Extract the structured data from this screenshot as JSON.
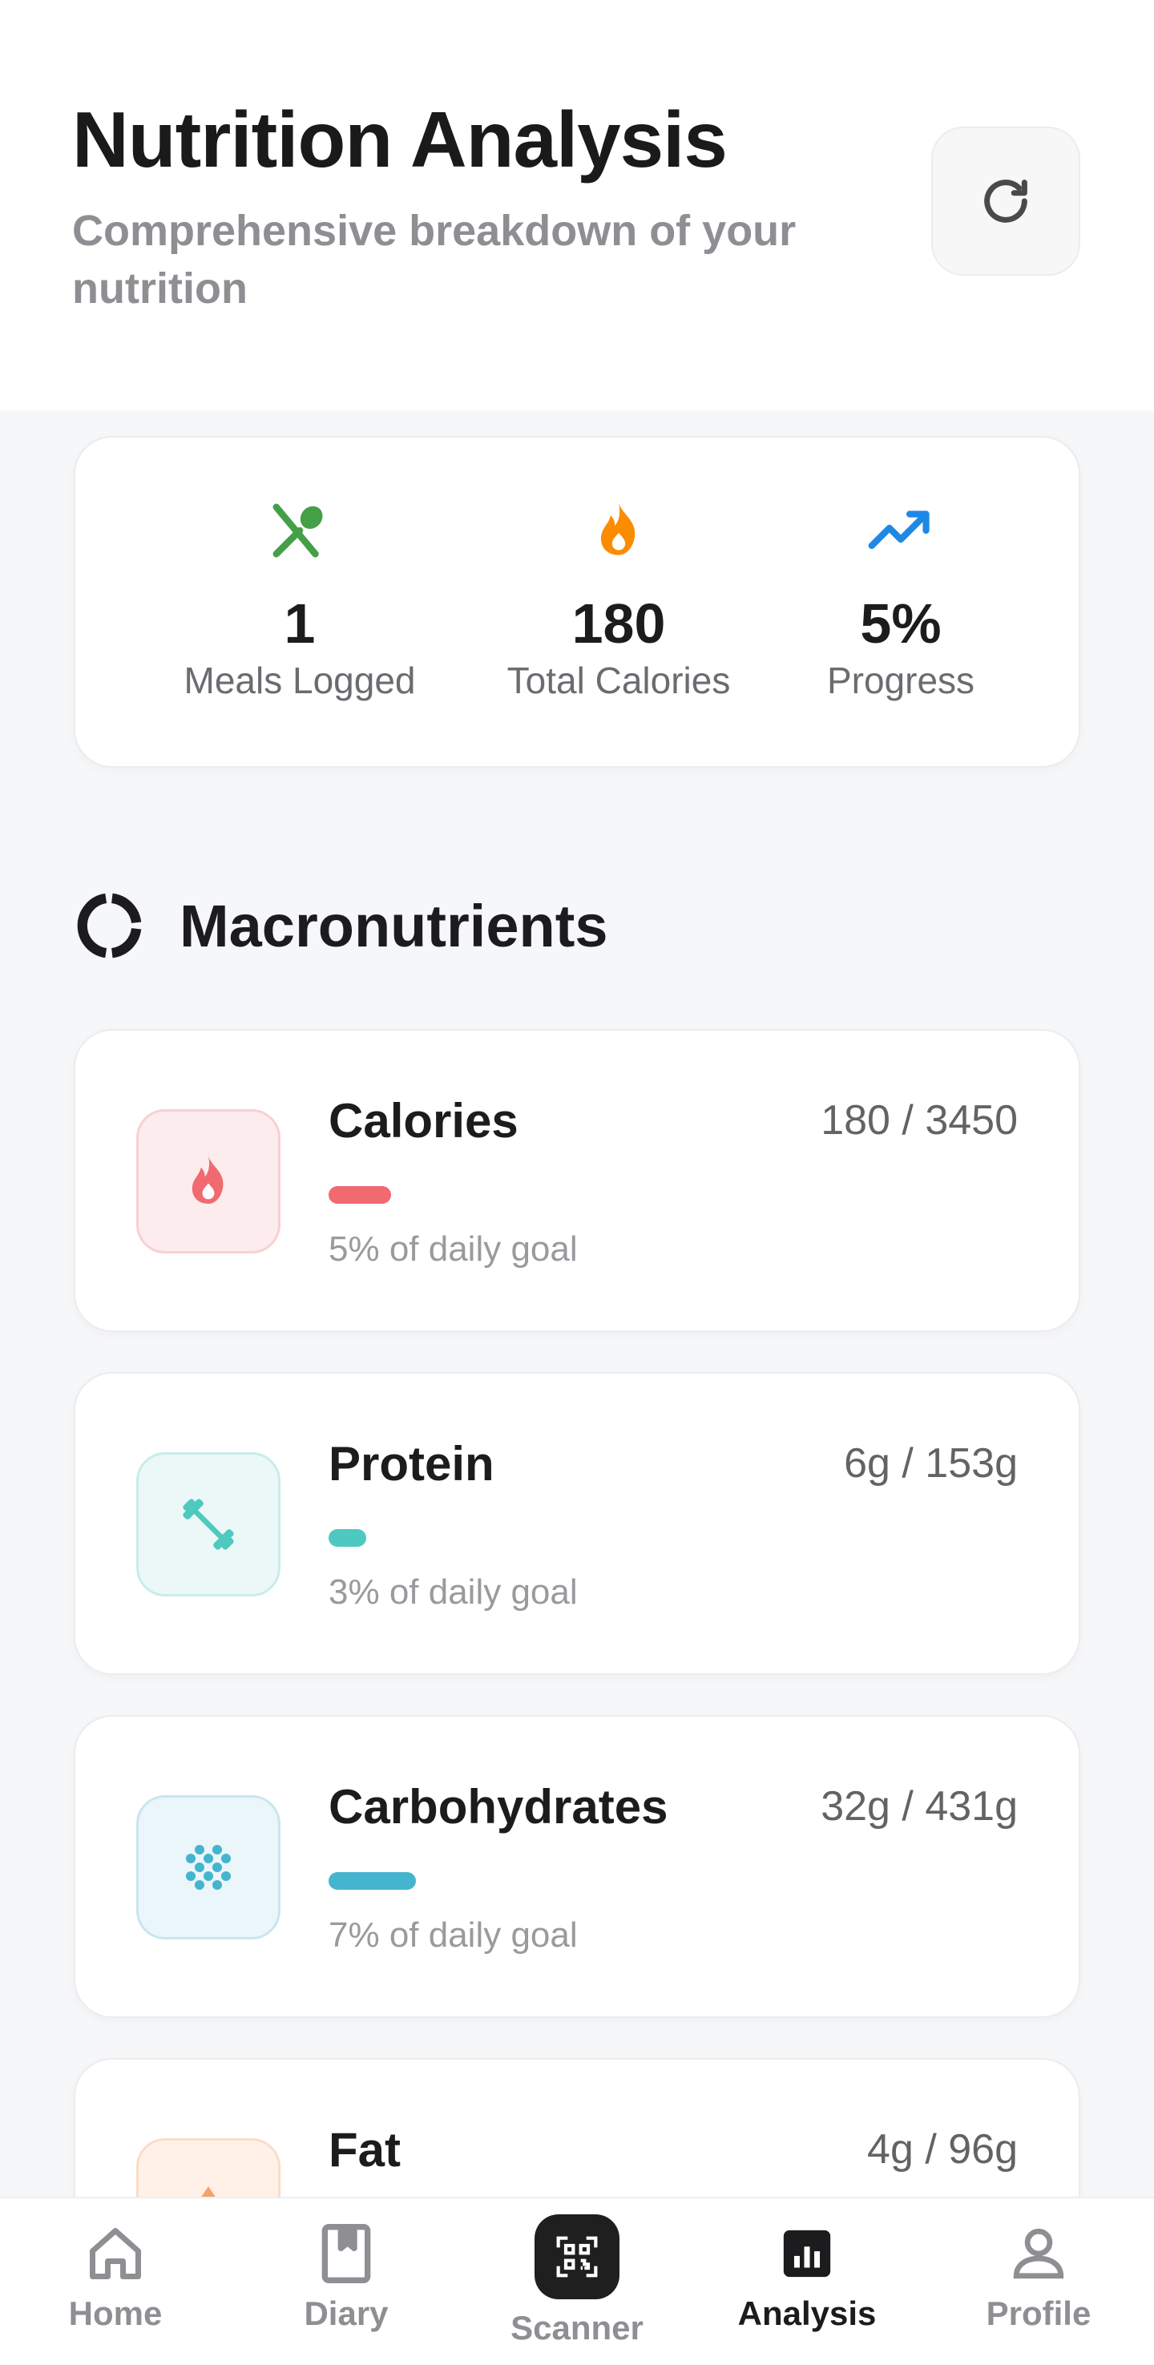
{
  "header": {
    "title": "Nutrition Analysis",
    "subtitle": "Comprehensive breakdown of your nutrition",
    "refresh_icon": "refresh-icon"
  },
  "stats": [
    {
      "icon": "utensils-icon",
      "value": "1",
      "label": "Meals Logged",
      "color": "#43a047"
    },
    {
      "icon": "flame-icon",
      "value": "180",
      "label": "Total Calories",
      "color": "#fb8c00"
    },
    {
      "icon": "trending-up-icon",
      "value": "5%",
      "label": "Progress",
      "color": "#1e88e5"
    }
  ],
  "macros_section": {
    "icon": "donut-chart-icon",
    "title": "Macronutrients"
  },
  "macros": [
    {
      "name": "Calories",
      "amount": "180 / 3450",
      "goal_text": "5% of daily goal",
      "progress": 0.05,
      "icon": "flame-icon",
      "color": "#f06a6f",
      "bg": "#fdecee",
      "border": "#f8d0d4"
    },
    {
      "name": "Protein",
      "amount": "6g / 153g",
      "goal_text": "3% of daily goal",
      "progress": 0.03,
      "icon": "dumbbell-icon",
      "color": "#4ec9c0",
      "bg": "#ebf8f7",
      "border": "#c9ecea"
    },
    {
      "name": "Carbohydrates",
      "amount": "32g / 431g",
      "goal_text": "7% of daily goal",
      "progress": 0.07,
      "icon": "grain-icon",
      "color": "#45b5cf",
      "bg": "#eaf6fa",
      "border": "#c8e6ef"
    },
    {
      "name": "Fat",
      "amount": "4g / 96g",
      "goal_text": "",
      "progress": 0.04,
      "icon": "droplet-icon",
      "color": "#f4a26b",
      "bg": "#fff1e8",
      "border": "#fbdcc6"
    }
  ],
  "nav": {
    "items": [
      {
        "label": "Home",
        "icon": "home-icon",
        "active": false
      },
      {
        "label": "Diary",
        "icon": "book-icon",
        "active": false
      },
      {
        "label": "Scanner",
        "icon": "qr-scanner-icon",
        "active": false
      },
      {
        "label": "Analysis",
        "icon": "bar-chart-icon",
        "active": true
      },
      {
        "label": "Profile",
        "icon": "user-icon",
        "active": false
      }
    ]
  }
}
